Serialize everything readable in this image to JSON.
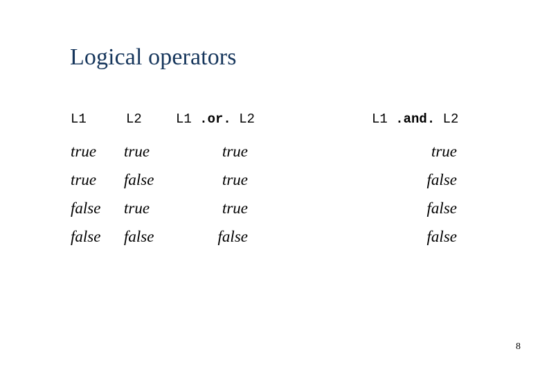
{
  "slide": {
    "title": "Logical operators",
    "page_number": "8",
    "background_color": "#ffffff",
    "title_color": "#16365c",
    "text_color": "#000000"
  },
  "table": {
    "headers": {
      "l1": "L1",
      "l2": "L2",
      "or_prefix": "L1 ",
      "or_operator": ".or.",
      "or_suffix": " L2",
      "and_prefix": "L1 ",
      "and_operator": ".and.",
      "and_suffix": " L2"
    },
    "rows": [
      {
        "l1": "true",
        "l2": "true",
        "or": "true",
        "and": "true"
      },
      {
        "l1": "true",
        "l2": "false",
        "or": "true",
        "and": "false"
      },
      {
        "l1": "false",
        "l2": "true",
        "or": "true",
        "and": "false"
      },
      {
        "l1": "false",
        "l2": "false",
        "or": "false",
        "and": "false"
      }
    ]
  }
}
